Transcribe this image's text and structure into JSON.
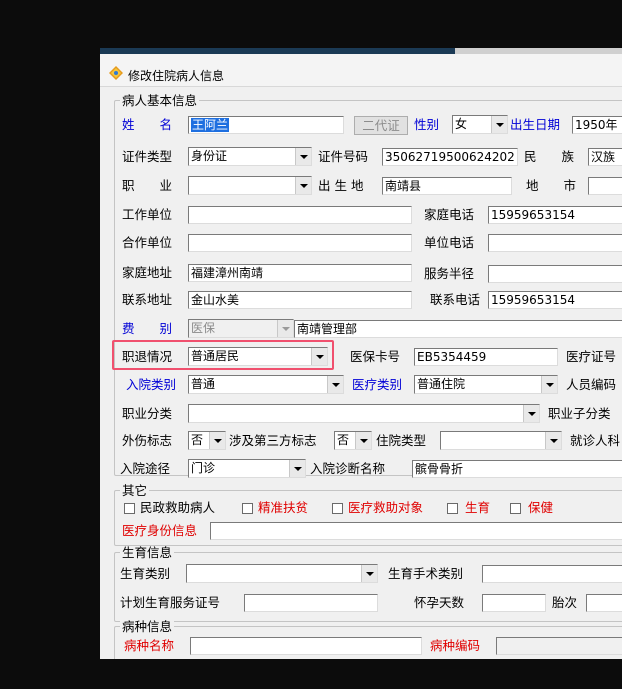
{
  "window": {
    "title": "修改住院病人信息"
  },
  "basic": {
    "group_title": "病人基本信息",
    "name_label": "姓　　名",
    "name_value": "王阿兰",
    "second_id_button": "二代证",
    "gender_label": "性别",
    "gender_value": "女",
    "birth_label": "出生日期",
    "birth_value": "1950年",
    "id_type_label": "证件类型",
    "id_type_value": "身份证",
    "id_no_label": "证件号码",
    "id_no_value": "35062719500624202",
    "ethnic_label": "民　　族",
    "ethnic_value": "汉族",
    "job_label": "职　　业",
    "job_value": "",
    "birthplace_label": "出 生 地",
    "birthplace_value": "南靖县",
    "city_label": "地　　市",
    "work_unit_label": "工作单位",
    "home_phone_label": "家庭电话",
    "home_phone_value": "15959653154",
    "coop_unit_label": "合作单位",
    "unit_phone_label": "单位电话",
    "home_addr_label": "家庭地址",
    "home_addr_value": "福建漳州南靖",
    "service_radius_label": "服务半径",
    "contact_addr_label": "联系地址",
    "contact_addr_value": "金山水美",
    "contact_phone_label": "联系电话",
    "contact_phone_value": "15959653154",
    "fee_label": "费　　别",
    "fee_value": "医保",
    "fee_extra_value": "南靖管理部",
    "retire_label": "职退情况",
    "retire_value": "普通居民",
    "insurance_card_label": "医保卡号",
    "insurance_card_value": "EB5354459",
    "medical_cert_label": "医疗证号",
    "admit_type_label": "入院类别",
    "admit_type_value": "普通",
    "med_type_label": "医疗类别",
    "med_type_value": "普通住院",
    "staff_code_label": "人员编码",
    "job_class_label": "职业分类",
    "job_subclass_label": "职业子分类",
    "injury_label": "外伤标志",
    "injury_value": "否",
    "third_party_label": "涉及第三方标志",
    "third_party_value": "否",
    "ward_type_label": "住院类型",
    "doctor_label": "就诊人科",
    "admit_route_label": "入院途径",
    "admit_route_value": "门诊",
    "diagnosis_label": "入院诊断名称",
    "diagnosis_value": "髌骨骨折"
  },
  "other": {
    "group_title": "其它",
    "checkboxes": [
      {
        "label": "民政救助病人",
        "color": "#000000"
      },
      {
        "label": "精准扶贫",
        "color": "#e00000"
      },
      {
        "label": "医疗救助对象",
        "color": "#e00000"
      },
      {
        "label": "生育",
        "color": "#e00000"
      },
      {
        "label": "保健",
        "color": "#e00000"
      }
    ],
    "medical_identity_label": "医疗身份信息"
  },
  "maternity": {
    "group_title": "生育信息",
    "type_label": "生育类别",
    "surgery_label": "生育手术类别",
    "cert_label": "计划生育服务证号",
    "pregnancy_days_label": "怀孕天数",
    "fetus_label": "胎次"
  },
  "disease": {
    "group_title": "病种信息",
    "name_label": "病种名称",
    "code_label": "病种编码"
  },
  "colors": {
    "label_blue": "#0000d6",
    "label_red": "#e00000",
    "highlight": "#f0506e"
  }
}
